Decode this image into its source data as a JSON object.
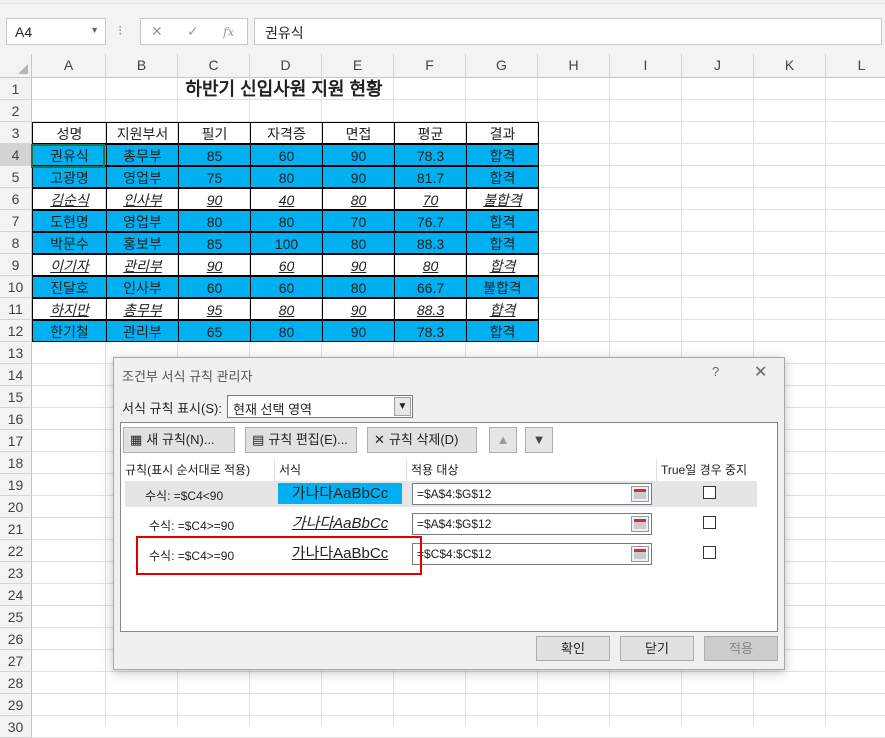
{
  "formula_bar": {
    "name_box": "A4",
    "cancel_glyph": "✕",
    "enter_glyph": "✓",
    "fx_glyph": "fx",
    "formula": "권유식"
  },
  "columns": [
    "A",
    "B",
    "C",
    "D",
    "E",
    "F",
    "G",
    "H",
    "I",
    "J",
    "K",
    "L"
  ],
  "rows": [
    "1",
    "2",
    "3",
    "4",
    "5",
    "6",
    "7",
    "8",
    "9",
    "10",
    "11",
    "12",
    "13",
    "14",
    "15",
    "16",
    "17",
    "18",
    "19",
    "20",
    "21",
    "22",
    "23",
    "24",
    "25",
    "26",
    "27",
    "28",
    "29",
    "30"
  ],
  "sheet": {
    "title": "하반기 신입사원 지원 현황",
    "headers": [
      "성명",
      "지원부서",
      "필기",
      "자격증",
      "면접",
      "평균",
      "결과"
    ],
    "data": [
      {
        "cells": [
          "권유식",
          "총무부",
          "85",
          "60",
          "90",
          "78.3",
          "합격"
        ],
        "style": "blue"
      },
      {
        "cells": [
          "고광명",
          "영업부",
          "75",
          "80",
          "90",
          "81.7",
          "합격"
        ],
        "style": "blue"
      },
      {
        "cells": [
          "김순식",
          "인사부",
          "90",
          "40",
          "80",
          "70",
          "불합격"
        ],
        "style": "uline"
      },
      {
        "cells": [
          "도현명",
          "영업부",
          "80",
          "80",
          "70",
          "76.7",
          "합격"
        ],
        "style": "blue"
      },
      {
        "cells": [
          "박문수",
          "홍보부",
          "85",
          "100",
          "80",
          "88.3",
          "합격"
        ],
        "style": "blue"
      },
      {
        "cells": [
          "이기자",
          "관리부",
          "90",
          "60",
          "90",
          "80",
          "합격"
        ],
        "style": "uline"
      },
      {
        "cells": [
          "진달호",
          "인사부",
          "60",
          "60",
          "80",
          "66.7",
          "불합격"
        ],
        "style": "blue"
      },
      {
        "cells": [
          "하지만",
          "총무부",
          "95",
          "80",
          "90",
          "88.3",
          "합격"
        ],
        "style": "uline"
      },
      {
        "cells": [
          "한기철",
          "관리부",
          "65",
          "80",
          "90",
          "78.3",
          "합격"
        ],
        "style": "blue"
      }
    ]
  },
  "dialog": {
    "title": "조건부 서식 규칙 관리자",
    "help": "?",
    "close": "✕",
    "show_label": "서식 규칙 표시(S):",
    "show_value": "현재 선택 영역",
    "buttons": {
      "new_rule": "새 규칙(N)...",
      "edit_rule": "규칙 편집(E)...",
      "delete_rule": "규칙 삭제(D)",
      "up": "▲",
      "down": "▼"
    },
    "columns": {
      "rule": "규칙(표시 순서대로 적용)",
      "format": "서식",
      "applies_to": "적용 대상",
      "stop_if_true": "True일 경우 중지"
    },
    "rules": [
      {
        "rule": "수식: =$C4<90",
        "preview": "가나다AaBbCc",
        "range": "=$A$4:$G$12"
      },
      {
        "rule": "수식: =$C4>=90",
        "preview": "가나다AaBbCc",
        "range": "=$A$4:$G$12"
      },
      {
        "rule": "수식: =$C4>=90",
        "preview": "가나다AaBbCc",
        "range": "=$C$4:$C$12"
      }
    ],
    "ok": "확인",
    "close_btn": "닫기",
    "apply": "적용"
  }
}
